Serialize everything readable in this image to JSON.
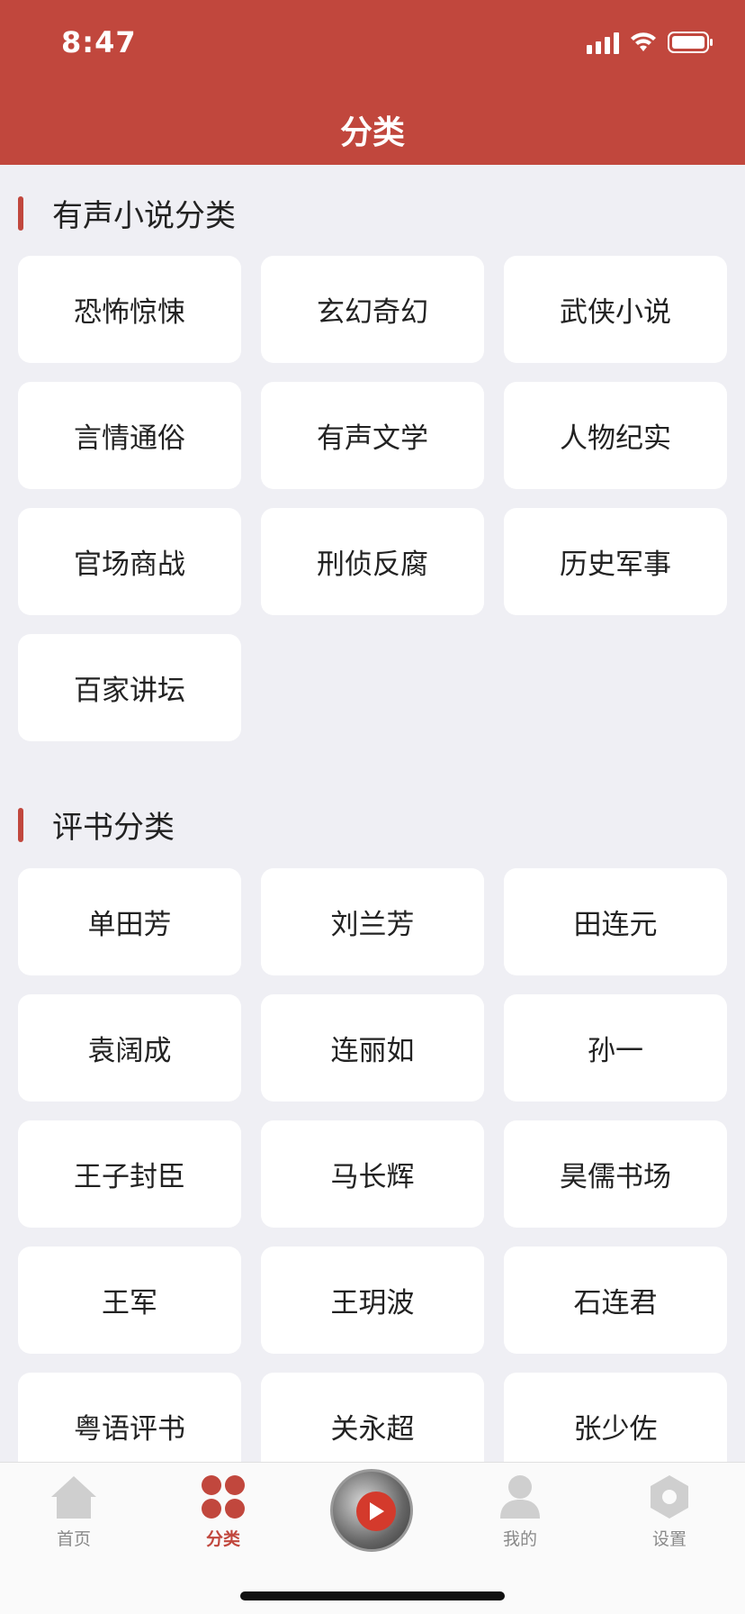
{
  "status_bar": {
    "time": "8:47"
  },
  "header": {
    "title": "分类"
  },
  "sections": [
    {
      "title": "有声小说分类",
      "items": [
        "恐怖惊悚",
        "玄幻奇幻",
        "武侠小说",
        "言情通俗",
        "有声文学",
        "人物纪实",
        "官场商战",
        "刑侦反腐",
        "历史军事",
        "百家讲坛"
      ]
    },
    {
      "title": "评书分类",
      "items": [
        "单田芳",
        "刘兰芳",
        "田连元",
        "袁阔成",
        "连丽如",
        "孙一",
        "王子封臣",
        "马长辉",
        "昊儒书场",
        "王军",
        "王玥波",
        "石连君",
        "粤语评书",
        "关永超",
        "张少佐"
      ]
    }
  ],
  "tabbar": {
    "items": [
      {
        "label": "首页",
        "icon": "home-icon"
      },
      {
        "label": "分类",
        "icon": "category-icon",
        "active": true
      },
      {
        "label": "",
        "icon": "player-disc-icon"
      },
      {
        "label": "我的",
        "icon": "user-icon"
      },
      {
        "label": "设置",
        "icon": "settings-icon"
      }
    ]
  },
  "colors": {
    "accent": "#c1473d",
    "background": "#efeff4",
    "card": "#ffffff"
  }
}
